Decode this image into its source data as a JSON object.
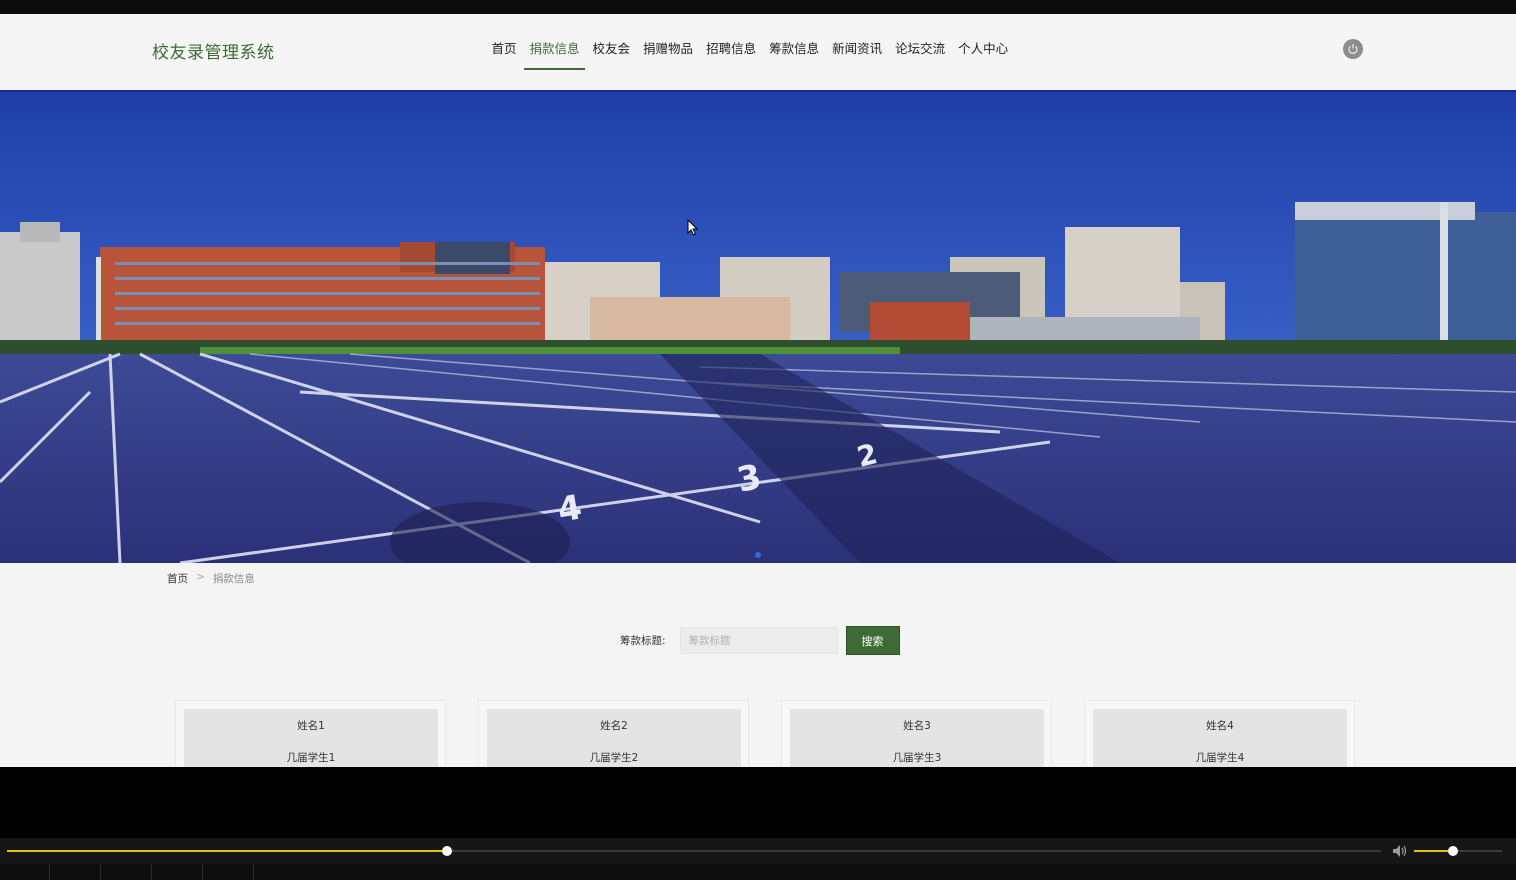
{
  "header": {
    "logo": "校友录管理系统",
    "nav": [
      {
        "label": "首页",
        "active": false
      },
      {
        "label": "捐款信息",
        "active": true
      },
      {
        "label": "校友会",
        "active": false
      },
      {
        "label": "捐赠物品",
        "active": false
      },
      {
        "label": "招聘信息",
        "active": false
      },
      {
        "label": "筹款信息",
        "active": false
      },
      {
        "label": "新闻资讯",
        "active": false
      },
      {
        "label": "论坛交流",
        "active": false
      },
      {
        "label": "个人中心",
        "active": false
      }
    ],
    "power_icon": "power-icon"
  },
  "breadcrumb": {
    "home": "首页",
    "separator": ">",
    "current": "捐款信息"
  },
  "search": {
    "label": "筹款标题:",
    "placeholder": "筹款标题",
    "value": "",
    "button": "搜索"
  },
  "cards": [
    {
      "name": "姓名1",
      "class": "几届学生1"
    },
    {
      "name": "姓名2",
      "class": "几届学生2"
    },
    {
      "name": "姓名3",
      "class": "几届学生3"
    },
    {
      "name": "姓名4",
      "class": "几届学生4"
    }
  ],
  "player": {
    "progress": 0.32,
    "volume": 0.44
  },
  "colors": {
    "accent": "#3e6b35",
    "header_border": "#1a2a8c",
    "progress": "#e6c200"
  }
}
